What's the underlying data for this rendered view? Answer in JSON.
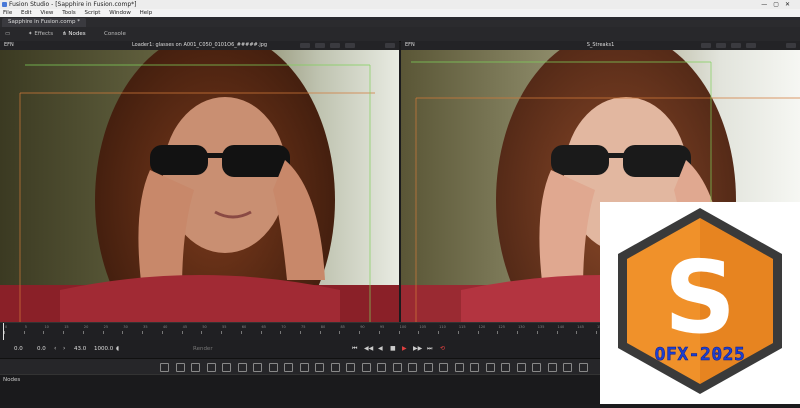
{
  "window": {
    "title": "Fusion Studio - [Sapphire in Fusion.comp*]"
  },
  "menu": [
    "File",
    "Edit",
    "View",
    "Tools",
    "Script",
    "Window",
    "Help"
  ],
  "tab": {
    "label": "Sapphire in Fusion.comp *"
  },
  "toolbar": {
    "effects": "Effects",
    "nodes": "Nodes",
    "console": "Console"
  },
  "viewers": {
    "left": {
      "title": "Loader1: glasses on A001_C050_0101O6_#####.jpg",
      "mode": "EFN"
    },
    "right": {
      "title": "S_Streaks1",
      "mode": "EFN"
    }
  },
  "timeline": {
    "ticks": [
      "0",
      "5",
      "10",
      "15",
      "20",
      "25",
      "30",
      "35",
      "40",
      "45",
      "50",
      "55",
      "60",
      "65",
      "70",
      "75",
      "80",
      "85",
      "90",
      "95",
      "100",
      "105",
      "110",
      "115",
      "120",
      "125",
      "130",
      "135",
      "140",
      "145",
      "150"
    ]
  },
  "transport": {
    "start": "0.0",
    "current": "0.0",
    "end_current": "43.0",
    "end": "1000.0",
    "render": "Render"
  },
  "nodes_panel": {
    "label": "Nodes"
  },
  "badge": {
    "text": "OFX-2025",
    "letter": "S"
  },
  "colors": {
    "brand_orange": "#f0912a",
    "badge_blue": "#1d3fd1",
    "hex_border": "#3a3a3a"
  }
}
